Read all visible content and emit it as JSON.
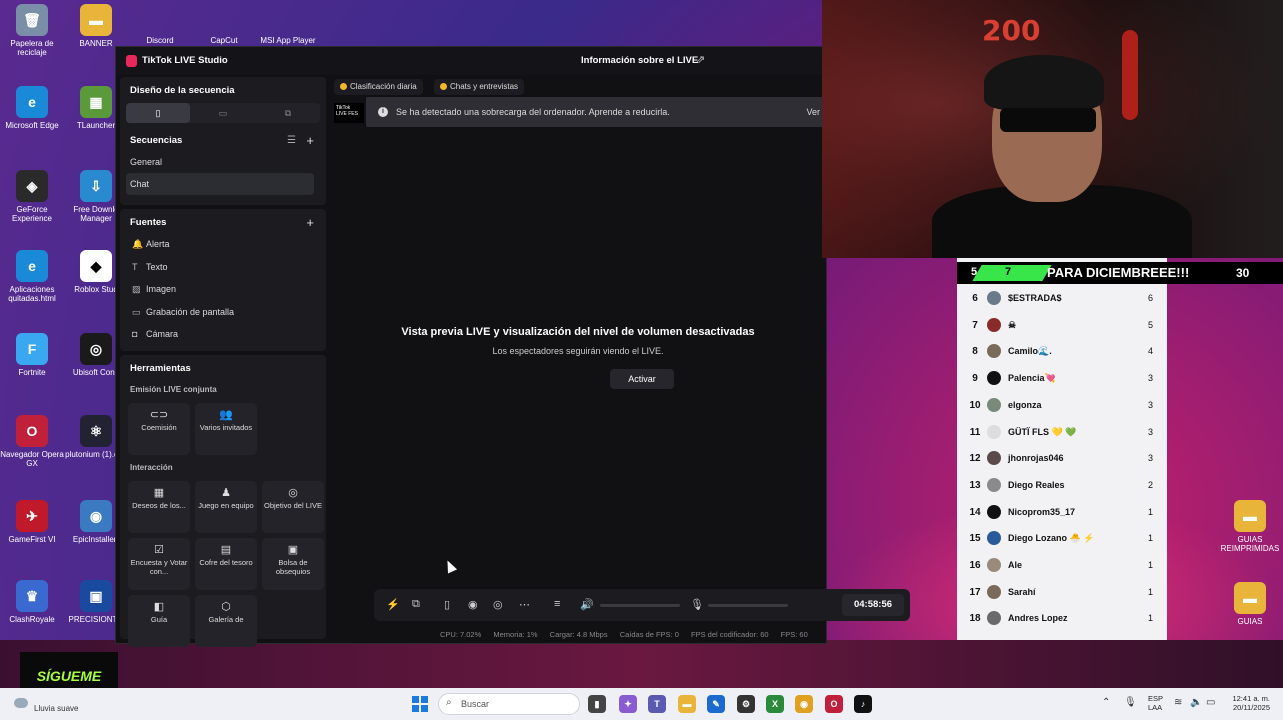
{
  "desktop": {
    "icons": [
      {
        "label": "Papelera de reciclaje",
        "color": "#7a8ea8",
        "glyph": "🗑"
      },
      {
        "label": "BANNER",
        "color": "#e8b53a",
        "glyph": "▬"
      },
      {
        "label": "Microsoft Edge",
        "color": "#1a8ad8",
        "glyph": "e"
      },
      {
        "label": "TLauncher",
        "color": "#5a9a3a",
        "glyph": "▦"
      },
      {
        "label": "GeForce Experience",
        "color": "#2a2a2a",
        "glyph": "◈"
      },
      {
        "label": "Free Downlo Manager",
        "color": "#2a8ad0",
        "glyph": "⇩"
      },
      {
        "label": "Aplicaciones quitadas.html",
        "color": "#1a8ad8",
        "glyph": "e"
      },
      {
        "label": "Roblox Stud",
        "color": "#ffffff",
        "glyph": "◆"
      },
      {
        "label": "Fortnite",
        "color": "#3aa8f0",
        "glyph": "F"
      },
      {
        "label": "Ubisoft Conn",
        "color": "#1a1a1a",
        "glyph": "◎"
      },
      {
        "label": "Navegador Opera GX",
        "color": "#c0203a",
        "glyph": "O"
      },
      {
        "label": "plutonium (1).exe",
        "color": "#223",
        "glyph": "⚛"
      },
      {
        "label": "GameFirst VI",
        "color": "#c01a2a",
        "glyph": "✈"
      },
      {
        "label": "EpicInstaller-",
        "color": "#3a7ac0",
        "glyph": "◉"
      },
      {
        "label": "ClashRoyale",
        "color": "#3a6ad0",
        "glyph": "♛"
      },
      {
        "label": "PRECISIONTO",
        "color": "#1a4aa0",
        "glyph": "▣"
      },
      {
        "label": "GUIAS REIMPRIMIDAS",
        "color": "#e8b53a",
        "glyph": "▬"
      },
      {
        "label": "GUIAS",
        "color": "#e8b53a",
        "glyph": "▬"
      }
    ],
    "top_partial": [
      "Discord",
      "CapCut",
      "MSI App Player"
    ]
  },
  "studio": {
    "title": "TikTok LIVE Studio",
    "live_info": "Información sobre el LIVE",
    "scene_design": "Diseño de la secuencia",
    "sequences": {
      "title": "Secuencias",
      "items": [
        "General",
        "Chat"
      ],
      "selected": "Chat"
    },
    "sources": {
      "title": "Fuentes",
      "items": [
        {
          "label": "Alerta",
          "icon": "bell-icon",
          "glyph": "🔔"
        },
        {
          "label": "Texto",
          "icon": "text-icon",
          "glyph": "T"
        },
        {
          "label": "Imagen",
          "icon": "image-icon",
          "glyph": "▨"
        },
        {
          "label": "Grabación de pantalla",
          "icon": "monitor-icon",
          "glyph": "▭"
        },
        {
          "label": "Cámara",
          "icon": "camera-icon",
          "glyph": "◘"
        }
      ]
    },
    "tools": {
      "title": "Herramientas",
      "joint_live": "Emisión LIVE conjunta",
      "joint_items": [
        {
          "label": "Coemisión",
          "glyph": "⊂⊃"
        },
        {
          "label": "Varios invitados",
          "glyph": "👥"
        }
      ],
      "interaction": "Interacción",
      "interaction_items": [
        {
          "label": "Deseos de los...",
          "glyph": "▦"
        },
        {
          "label": "Juego en equipo",
          "glyph": "♟"
        },
        {
          "label": "Objetivo del LIVE",
          "glyph": "◎"
        },
        {
          "label": "Encuesta y Votar con...",
          "glyph": "☑"
        },
        {
          "label": "Cofre del tesoro",
          "glyph": "▤"
        },
        {
          "label": "Bolsa de obsequios",
          "glyph": "▣"
        },
        {
          "label": "Guía",
          "glyph": "◧"
        },
        {
          "label": "Galería de",
          "glyph": "⬡"
        }
      ]
    },
    "chips": [
      "Clasificación diaria",
      "Chats y entrevistas"
    ],
    "notification": {
      "text": "Se ha detectado una sobrecarga del ordenador. Aprende a reducirla.",
      "link": "Ver"
    },
    "thumb_text": "TikTok LIVE FES",
    "preview": {
      "title": "Vista previa LIVE y visualización del nivel de volumen desactivadas",
      "subtitle": "Los espectadores seguirán viendo el LIVE.",
      "button": "Activar"
    },
    "timer": "04:58:56",
    "stats": {
      "cpu": "CPU: 7.02%",
      "memory": "Memoria: 1%",
      "load": "Cargar: 4.8 Mbps",
      "fps_drops": "Caídas de FPS: 0",
      "encoder_fps": "FPS del codificador: 60",
      "fps": "FPS: 60"
    }
  },
  "webcam": {
    "neon": "200"
  },
  "leaderboard": {
    "banner": {
      "rank": "5",
      "num": "7",
      "text": "PARA DICIEMBREEE!!!",
      "score": "30"
    },
    "rows": [
      {
        "rank": "6",
        "name": "$ESTRADA$",
        "score": "6",
        "avatar": "#6a7a8a"
      },
      {
        "rank": "7",
        "name": "☠",
        "score": "5",
        "avatar": "#8a2a2a"
      },
      {
        "rank": "8",
        "name": "Camilo🌊.",
        "score": "4",
        "avatar": "#7a6a5a"
      },
      {
        "rank": "9",
        "name": "Palencia💘",
        "score": "3",
        "avatar": "#111111"
      },
      {
        "rank": "10",
        "name": "elgonza",
        "score": "3",
        "avatar": "#7a8a7a"
      },
      {
        "rank": "11",
        "name": "GÜTÏ FLS 💛 💚",
        "score": "3",
        "avatar": "#dddddd"
      },
      {
        "rank": "12",
        "name": "jhonrojas046",
        "score": "3",
        "avatar": "#5a4a4a"
      },
      {
        "rank": "13",
        "name": "Diego Reales",
        "score": "2",
        "avatar": "#8a8a8a"
      },
      {
        "rank": "14",
        "name": "Nicoprom35_17",
        "score": "1",
        "avatar": "#111111"
      },
      {
        "rank": "15",
        "name": "Diego Lozano 🐣 ⚡",
        "score": "1",
        "avatar": "#2a5a9a"
      },
      {
        "rank": "16",
        "name": "Ale",
        "score": "1",
        "avatar": "#9a8a7a"
      },
      {
        "rank": "17",
        "name": "Sarahí",
        "score": "1",
        "avatar": "#7a6a5a"
      },
      {
        "rank": "18",
        "name": "Andres Lopez",
        "score": "1",
        "avatar": "#6a6a6a"
      }
    ]
  },
  "overlay": {
    "sigueme": "SÍGUEME"
  },
  "taskbar": {
    "weather": "Lluvia suave",
    "search_placeholder": "Buscar",
    "lang1": "ESP",
    "lang2": "LAA",
    "time": "12:41 a. m.",
    "date": "20/11/2025"
  }
}
